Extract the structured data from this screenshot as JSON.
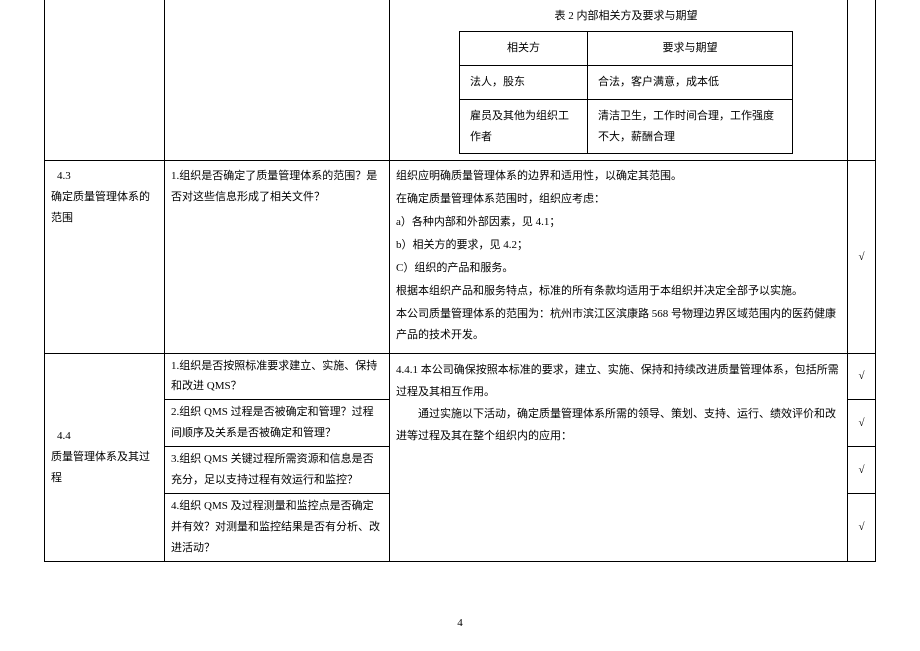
{
  "innerTable": {
    "caption": "表 2 内部相关方及要求与期望",
    "headers": [
      "相关方",
      "要求与期望"
    ],
    "rows": [
      [
        "法人，股东",
        "合法，客户满意，成本低"
      ],
      [
        "雇员及其他为组织工作者",
        "清洁卫生，工作时间合理，工作强度不大，薪酬合理"
      ]
    ]
  },
  "row43": {
    "col1_no": "4.3",
    "col1_title": "确定质量管理体系的范围",
    "col2": "1.组织是否确定了质量管理体系的范围？是否对这些信息形成了相关文件？",
    "col3_lines": [
      "组织应明确质量管理体系的边界和适用性，以确定其范围。",
      "在确定质量管理体系范围时，组织应考虑：",
      "a）各种内部和外部因素，见 4.1；",
      "b）相关方的要求，见 4.2；",
      "C）组织的产品和服务。",
      "根据本组织产品和服务特点，标准的所有条款均适用于本组织并决定全部予以实施。",
      "本公司质量管理体系的范围为：杭州市滨江区滨康路 568 号物理边界区域范围内的医药健康产品的技术开发。"
    ],
    "check": "√"
  },
  "row44": {
    "col1_no": "4.4",
    "col1_title": "质量管理体系及其过程",
    "q1": "1.组织是否按照标准要求建立、实施、保持和改进 QMS？",
    "q2": "2.组织 QMS 过程是否被确定和管理？过程间顺序及关系是否被确定和管理？",
    "q3": "3.组织 QMS 关键过程所需资源和信息是否充分，足以支持过程有效运行和监控？",
    "q4": "4.组织 QMS 及过程测量和监控点是否确定并有效？对测量和监控结果是否有分析、改进活动？",
    "col3_lines": [
      "4.4.1 本公司确保按照本标准的要求，建立、实施、保持和持续改进质量管理体系，包括所需过程及其相互作用。",
      "　　通过实施以下活动，确定质量管理体系所需的领导、策划、支持、运行、绩效评价和改进等过程及其在整个组织内的应用："
    ],
    "c1": "√",
    "c2": "√",
    "c3": "√",
    "c4": "√"
  },
  "pageNumber": "4"
}
